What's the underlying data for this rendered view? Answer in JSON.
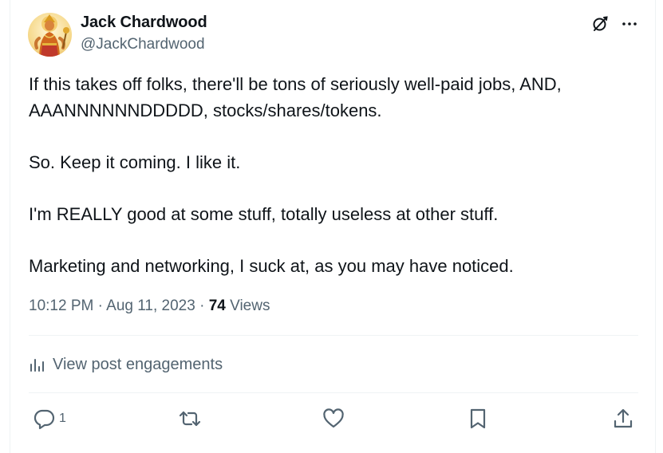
{
  "author": {
    "name": "Jack Chardwood",
    "handle": "@JackChardwood"
  },
  "post": {
    "paragraphs": [
      "If this takes off folks, there'll be tons of seriously well-paid jobs, AND, AAANNNNNNDDDDD, stocks/shares/tokens.",
      "So. Keep it coming. I like it.",
      "I'm REALLY good at some stuff, totally useless at other stuff.",
      "Marketing and networking, I suck at, as you may have noticed."
    ],
    "time": "10:12 PM",
    "separator": "·",
    "date": "Aug 11, 2023",
    "views_count": "74",
    "views_label": "Views"
  },
  "engagements": {
    "label": "View post engagements",
    "icon": "analytics-icon"
  },
  "actions": {
    "reply_count": "1",
    "icons": [
      "reply-icon",
      "repost-icon",
      "like-icon",
      "bookmark-icon",
      "share-icon"
    ]
  },
  "colors": {
    "text": "#0f1419",
    "secondary": "#536471",
    "divider": "#eff3f4",
    "avatar_background": "#fbe7a8"
  }
}
